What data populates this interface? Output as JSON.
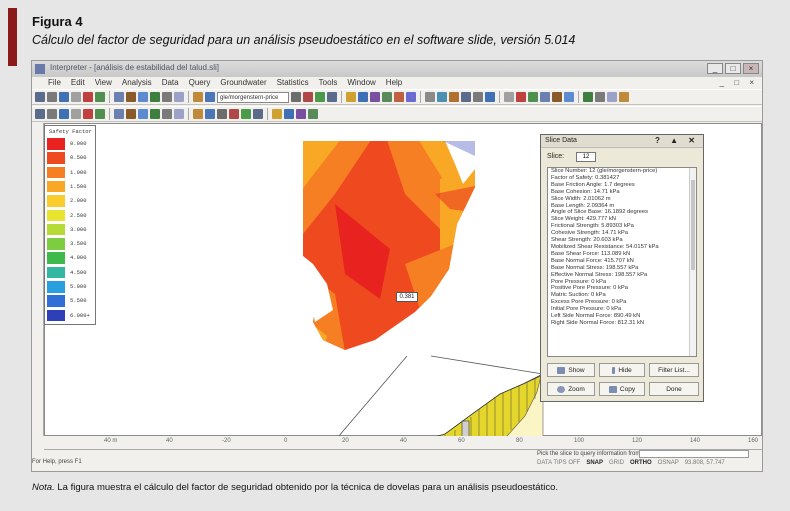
{
  "figure": {
    "label": "Figura 4",
    "caption": "Cálculo del factor de seguridad para un análisis pseudoestático en el software slide, versión 5.014",
    "note_prefix": "Nota.",
    "note_text": " La figura muestra el cálculo del factor de seguridad obtenido por la técnica de dovelas para un análisis pseudoestático."
  },
  "window": {
    "title": "Interpreter - [análisis de estabilidad del talud.sli]",
    "controls": [
      "_",
      "□",
      "×"
    ]
  },
  "menu": [
    "File",
    "Edit",
    "View",
    "Analysis",
    "Data",
    "Query",
    "Groundwater",
    "Statistics",
    "Tools",
    "Window",
    "Help"
  ],
  "mdi_controls": "_ □ ×",
  "toolbar": {
    "combo_value": "gle/morgenstern-price",
    "zoom_value": "100"
  },
  "legend": {
    "title": "Safety Factor",
    "entries": [
      {
        "label": "0.000",
        "color": "#e8231f"
      },
      {
        "label": "0.500",
        "color": "#ef4a1f"
      },
      {
        "label": "1.000",
        "color": "#f57f22"
      },
      {
        "label": "1.500",
        "color": "#f9a826"
      },
      {
        "label": "2.000",
        "color": "#fbcd2c"
      },
      {
        "label": "2.500",
        "color": "#e7e52f"
      },
      {
        "label": "3.000",
        "color": "#b6da36"
      },
      {
        "label": "3.500",
        "color": "#7ccd3f"
      },
      {
        "label": "4.000",
        "color": "#3fb84c"
      },
      {
        "label": "4.500",
        "color": "#33b7a1"
      },
      {
        "label": "5.000",
        "color": "#2a9fe0"
      },
      {
        "label": "5.500",
        "color": "#2f6fd6"
      },
      {
        "label": "6.000+",
        "color": "#2f3fb8"
      }
    ]
  },
  "factor_label": "0.381",
  "slice_panel": {
    "title": "Slice Data",
    "controls": "? ▲ ✕",
    "slice_label": "Slice:",
    "slice_value": "12",
    "lines": [
      "Slice Number: 12 (gle/morgenstern-price)",
      "Factor of Safety: 0.381427",
      "Base Friction Angle: 1.7 degrees",
      "Base Cohesion: 14.71 kPa",
      "Slice Width: 2.01062 m",
      "Base Length: 2.09364 m",
      "Angle of Slice Base: 16.1892 degrees",
      "Slice Weight: 429.777 kN",
      "Frictional Strength: 5.89303 kPa",
      "Cohesive Strength: 14.71 kPa",
      "Shear Strength: 20.603 kPa",
      "Mobilized Shear Resistance: 54.0157 kPa",
      "Base Shear Force: 113.089 kN",
      "Base Normal Force: 415.707 kN",
      "Base Normal Stress: 198.557 kPa",
      "Effective Normal Stress: 198.557 kPa",
      "Pore Pressure: 0 kPa",
      "Positive Pore Pressure: 0 kPa",
      "Matric Suction: 0 kPa",
      "Excess Pore Pressure: 0 kPa",
      "Initial Pore Pressure: 0 kPa",
      "Left Side Normal Force: 890.49 kN",
      "Right Side Normal Force: 812.31 kN"
    ],
    "buttons": {
      "show": "Show",
      "hide": "Hide",
      "filter": "Filter List...",
      "zoom": "Zoom",
      "copy": "Copy",
      "done": "Done"
    }
  },
  "ruler": [
    "40 m",
    "40",
    "-20",
    "0",
    "20",
    "40",
    "60",
    "80",
    "100",
    "120",
    "140",
    "160"
  ],
  "status": {
    "help": "For Help, press F1",
    "pick": "Pick the slice to query information from [esc=quit]",
    "items": [
      "DATA TIPS OFF",
      "SNAP",
      "GRID",
      "ORTHO",
      "OSNAP",
      "93.808, 57.747"
    ]
  }
}
